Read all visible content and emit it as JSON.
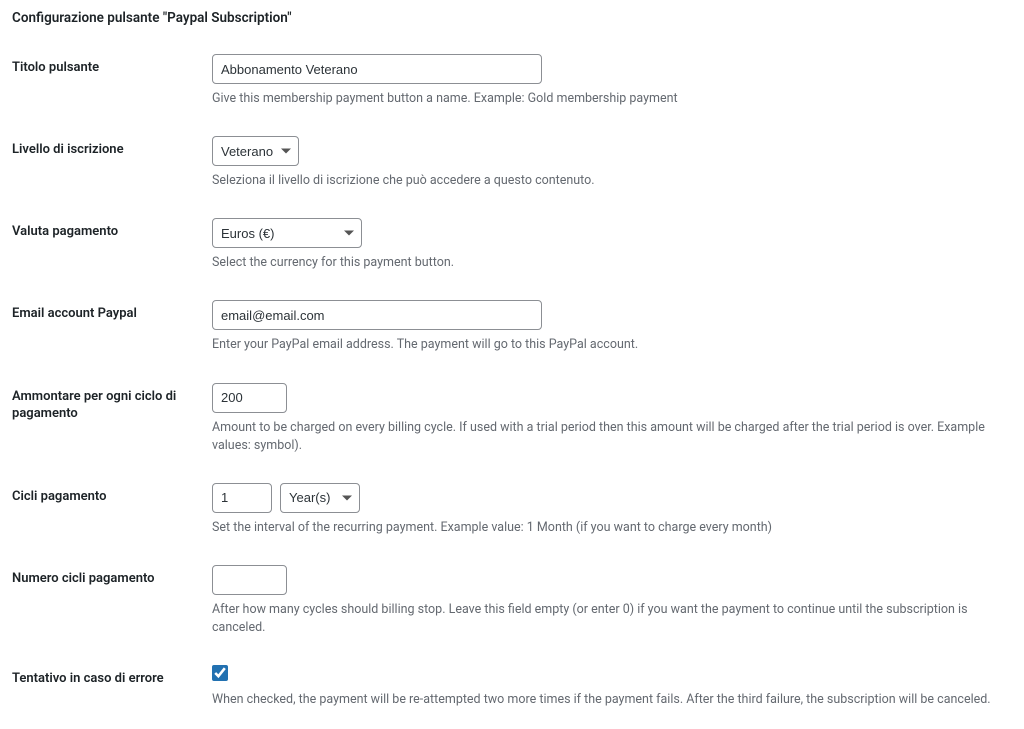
{
  "heading": "Configurazione pulsante \"Paypal Subscription\"",
  "fields": {
    "title": {
      "label": "Titolo pulsante",
      "value": "Abbonamento Veterano",
      "hint": "Give this membership payment button a name. Example: Gold membership payment"
    },
    "level": {
      "label": "Livello di iscrizione",
      "value": "Veterano",
      "hint": "Seleziona il livello di iscrizione che può accedere a questo contenuto."
    },
    "currency": {
      "label": "Valuta pagamento",
      "value": "Euros (€)",
      "hint": "Select the currency for this payment button."
    },
    "paypal_email": {
      "label": "Email account Paypal",
      "value": "email@email.com",
      "hint": "Enter your PayPal email address. The payment will go to this PayPal account."
    },
    "amount": {
      "label": "Ammontare per ogni ciclo di pagamento",
      "value": "200",
      "hint": "Amount to be charged on every billing cycle. If used with a trial period then this amount will be charged after the trial period is over. Example values: symbol)."
    },
    "cycles": {
      "label": "Cicli pagamento",
      "count_value": "1",
      "unit_value": "Year(s)",
      "hint": "Set the interval of the recurring payment. Example value: 1 Month (if you want to charge every month)"
    },
    "num_cycles": {
      "label": "Numero cicli pagamento",
      "value": "",
      "hint": "After how many cycles should billing stop. Leave this field empty (or enter 0) if you want the payment to continue until the subscription is canceled."
    },
    "retry": {
      "label": "Tentativo in caso di errore",
      "checked": true,
      "hint": "When checked, the payment will be re-attempted two more times if the payment fails. After the third failure, the subscription will be canceled."
    }
  }
}
